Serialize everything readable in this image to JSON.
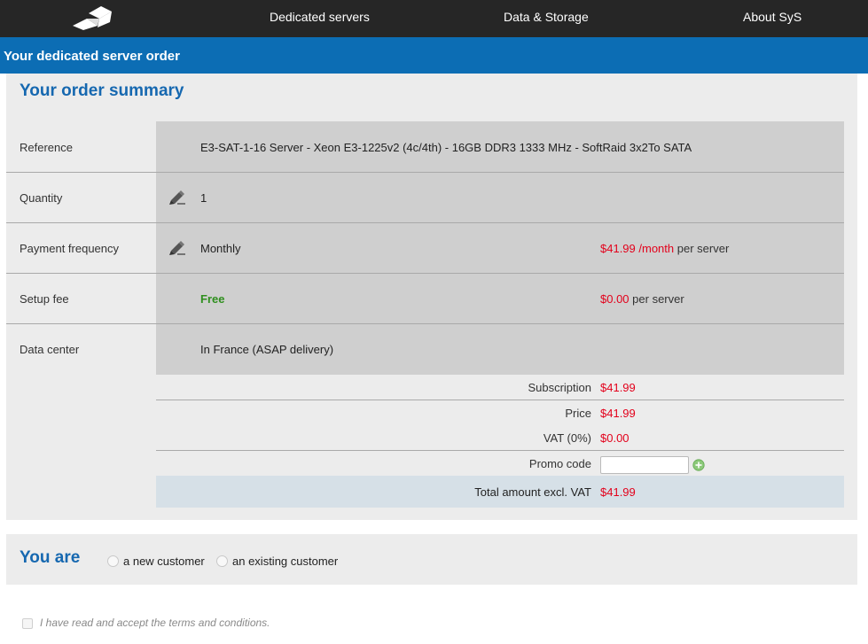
{
  "nav": {
    "links": [
      "Dedicated servers",
      "Data & Storage",
      "About SyS"
    ]
  },
  "title_bar": "Your dedicated server order",
  "summary": {
    "heading": "Your order summary",
    "rows": [
      {
        "label": "Reference",
        "value": "E3-SAT-1-16 Server - Xeon E3-1225v2 (4c/4th) - 16GB DDR3 1333 MHz - SoftRaid 3x2To SATA"
      },
      {
        "label": "Quantity",
        "value": "1",
        "editable": true
      },
      {
        "label": "Payment frequency",
        "value": "Monthly",
        "editable": true,
        "price": "$41.99",
        "price_unit": "/month",
        "price_suffix": "per server"
      },
      {
        "label": "Setup fee",
        "value": "Free",
        "price": "$0.00",
        "price_suffix": "per server"
      },
      {
        "label": "Data center",
        "value": "In France (ASAP delivery)"
      }
    ],
    "totals": {
      "subscription_label": "Subscription",
      "subscription_value": "$41.99",
      "price_label": "Price",
      "price_value": "$41.99",
      "vat_label": "VAT (0%)",
      "vat_value": "$0.00",
      "promo_label": "Promo code",
      "promo_value": "",
      "total_label": "Total amount excl. VAT",
      "total_value": "$41.99"
    }
  },
  "customer": {
    "heading": "You are",
    "options": [
      "a new customer",
      "an existing customer"
    ]
  },
  "terms": "I have read and accept the terms and conditions.",
  "colors": {
    "nav_bg": "#262626",
    "accent_blue": "#0c6db4",
    "heading_blue": "#1668b0",
    "price_red": "#e3001b",
    "free_green": "#2f8f1e"
  },
  "icons": [
    "logo",
    "pencil-edit-icon",
    "add-circle-icon"
  ]
}
